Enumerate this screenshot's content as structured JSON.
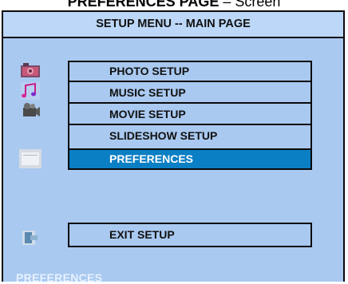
{
  "caption": {
    "bold": "PREFERENCES PAGE",
    "normal": " – Screen"
  },
  "header": {
    "title": "SETUP MENU -- MAIN PAGE"
  },
  "menu": {
    "items": [
      {
        "label": "PHOTO SETUP",
        "icon": "photo-icon"
      },
      {
        "label": "MUSIC SETUP",
        "icon": "music-icon"
      },
      {
        "label": "MOVIE SETUP",
        "icon": "movie-camera-icon"
      },
      {
        "label": "SLIDESHOW SETUP",
        "icon": "slideshow-icon"
      },
      {
        "label": "PREFERENCES",
        "selected": true
      }
    ],
    "exit_label": "EXIT SETUP",
    "exit_icon": "exit-icon"
  },
  "status": {
    "label": "PREFERENCES"
  },
  "colors": {
    "panel_bg": "#a9c9f0",
    "header_bg": "#bcd7f7",
    "selected_bg": "#0a7fc4",
    "border": "#0a0a0a",
    "status_text": "#e8f2ff"
  }
}
